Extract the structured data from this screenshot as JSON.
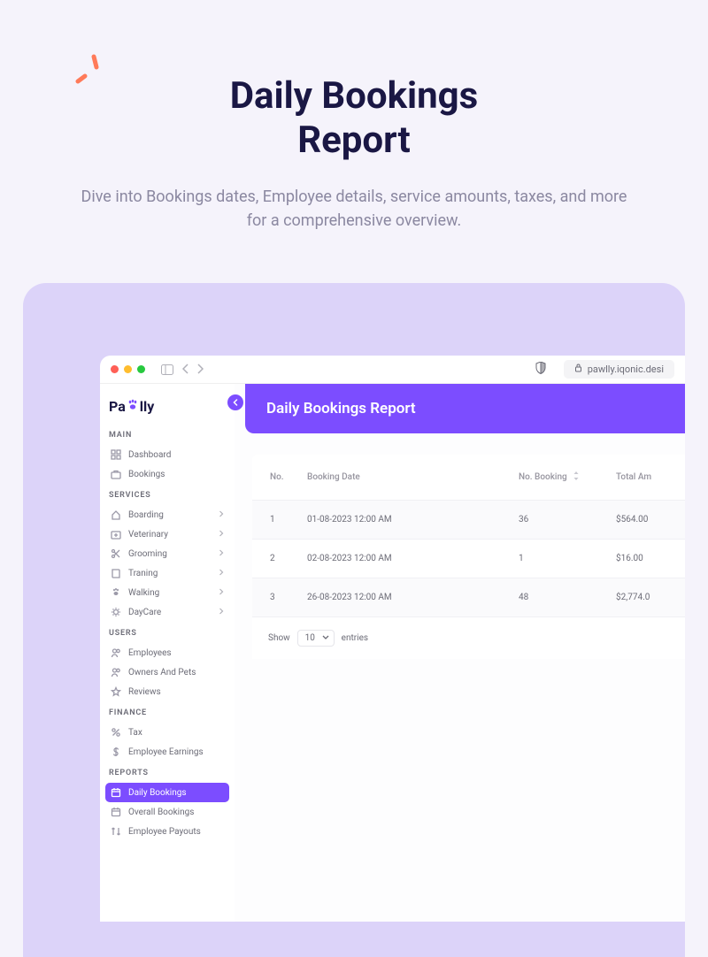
{
  "promo": {
    "title_line1": "Daily Bookings",
    "title_line2": "Report",
    "subtitle": "Dive into Bookings dates, Employee details, service amounts, taxes, and more for a comprehensive overview."
  },
  "browser": {
    "url": "pawlly.iqonic.desi"
  },
  "logo": {
    "part1": "Pa",
    "part2": "lly"
  },
  "sidebar": {
    "sections": [
      {
        "label": "MAIN",
        "items": [
          {
            "icon": "grid",
            "label": "Dashboard",
            "expandable": false
          },
          {
            "icon": "briefcase",
            "label": "Bookings",
            "expandable": false
          }
        ]
      },
      {
        "label": "SERVICES",
        "items": [
          {
            "icon": "home",
            "label": "Boarding",
            "expandable": true
          },
          {
            "icon": "medical",
            "label": "Veterinary",
            "expandable": true
          },
          {
            "icon": "scissors",
            "label": "Grooming",
            "expandable": true
          },
          {
            "icon": "book",
            "label": "Traning",
            "expandable": true
          },
          {
            "icon": "paw",
            "label": "Walking",
            "expandable": true
          },
          {
            "icon": "sun",
            "label": "DayCare",
            "expandable": true
          }
        ]
      },
      {
        "label": "USERS",
        "items": [
          {
            "icon": "users",
            "label": "Employees",
            "expandable": false
          },
          {
            "icon": "users",
            "label": "Owners And Pets",
            "expandable": false
          },
          {
            "icon": "star",
            "label": "Reviews",
            "expandable": false
          }
        ]
      },
      {
        "label": "FINANCE",
        "items": [
          {
            "icon": "percent",
            "label": "Tax",
            "expandable": false
          },
          {
            "icon": "dollar",
            "label": "Employee Earnings",
            "expandable": false
          }
        ]
      },
      {
        "label": "REPORTS",
        "items": [
          {
            "icon": "calendar",
            "label": "Daily Bookings",
            "expandable": false,
            "active": true
          },
          {
            "icon": "calendar",
            "label": "Overall Bookings",
            "expandable": false
          },
          {
            "icon": "arrows",
            "label": "Employee Payouts",
            "expandable": false
          }
        ]
      }
    ]
  },
  "page": {
    "header": "Daily Bookings Report"
  },
  "table": {
    "columns": [
      "No.",
      "Booking Date",
      "No. Booking",
      "Total Am"
    ],
    "rows": [
      {
        "no": "1",
        "date": "01-08-2023 12:00 AM",
        "count": "36",
        "amount": "$564.00"
      },
      {
        "no": "2",
        "date": "02-08-2023 12:00 AM",
        "count": "1",
        "amount": "$16.00"
      },
      {
        "no": "3",
        "date": "26-08-2023 12:00 AM",
        "count": "48",
        "amount": "$2,774.0"
      }
    ]
  },
  "pagination": {
    "show_label": "Show",
    "entries_label": "entries",
    "page_size": "10"
  }
}
